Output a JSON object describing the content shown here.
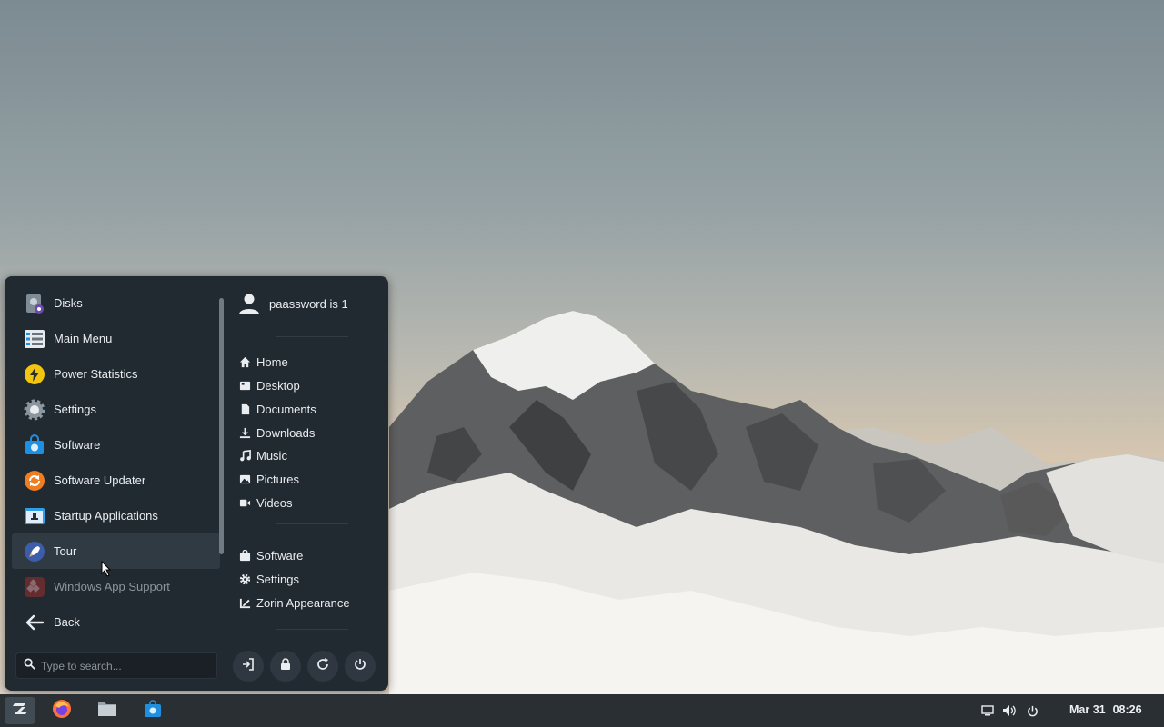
{
  "start_menu": {
    "apps": [
      {
        "label": "Disks",
        "icon": "disks-icon"
      },
      {
        "label": "Main Menu",
        "icon": "main-menu-icon"
      },
      {
        "label": "Power Statistics",
        "icon": "power-statistics-icon"
      },
      {
        "label": "Settings",
        "icon": "settings-gear-icon"
      },
      {
        "label": "Software",
        "icon": "software-store-icon"
      },
      {
        "label": "Software Updater",
        "icon": "software-updater-icon"
      },
      {
        "label": "Startup Applications",
        "icon": "startup-applications-icon"
      },
      {
        "label": "Tour",
        "icon": "rocket-icon",
        "state": "hover"
      },
      {
        "label": "Windows App Support",
        "icon": "windows-app-support-icon",
        "state": "disabled"
      },
      {
        "label": "Back",
        "icon": "back-arrow-icon"
      }
    ],
    "search": {
      "placeholder": "Type to search..."
    },
    "user": {
      "name": "paassword is 1"
    },
    "places": [
      {
        "label": "Home",
        "icon": "home-icon"
      },
      {
        "label": "Desktop",
        "icon": "desktop-icon"
      },
      {
        "label": "Documents",
        "icon": "document-icon"
      },
      {
        "label": "Downloads",
        "icon": "download-icon"
      },
      {
        "label": "Music",
        "icon": "music-icon"
      },
      {
        "label": "Pictures",
        "icon": "pictures-icon"
      },
      {
        "label": "Videos",
        "icon": "video-icon"
      }
    ],
    "system": [
      {
        "label": "Software",
        "icon": "software-bag-icon"
      },
      {
        "label": "Settings",
        "icon": "gear-icon"
      },
      {
        "label": "Zorin Appearance",
        "icon": "appearance-icon"
      }
    ],
    "session_buttons": [
      "logout-icon",
      "lock-icon",
      "restart-icon",
      "power-icon"
    ]
  },
  "taskbar": {
    "launchers": [
      "zorin-menu-icon",
      "firefox-icon",
      "files-icon",
      "software-store-icon"
    ],
    "tray": [
      "display-icon",
      "volume-icon",
      "power-icon"
    ],
    "date": "Mar 31",
    "time": "08:26"
  },
  "colors": {
    "menu_bg": "#222a31",
    "taskbar_bg": "#2a2f33",
    "hover_bg": "#303a43",
    "accent_blue": "#1f8fe0"
  }
}
